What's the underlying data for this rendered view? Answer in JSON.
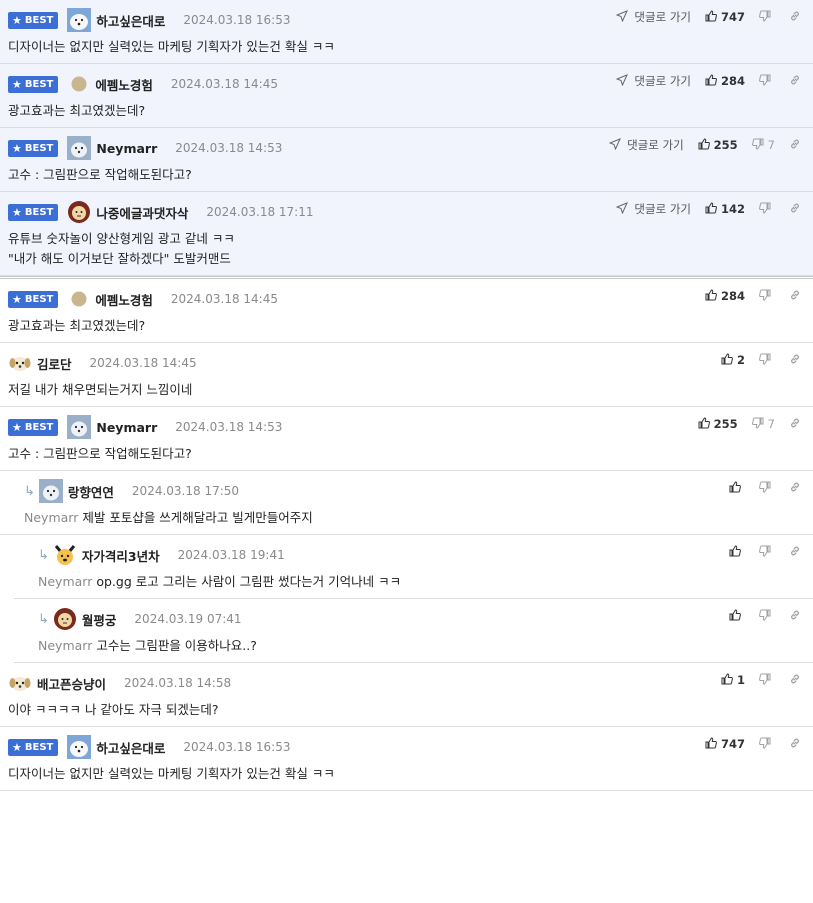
{
  "comments": [
    {
      "best": true,
      "badge": "BEST",
      "avatar": "polar-bear-avatar",
      "nick": "하고싶은대로",
      "date": "2024.03.18 16:53",
      "goto_label": "댓글로 가기",
      "likes": "747",
      "dislikes": "",
      "text": "디자이너는 없지만 실력있는 마케팅 기획자가 있는건 확실 ㅋㅋ"
    },
    {
      "best": true,
      "badge": "BEST",
      "avatar": "dot-avatar",
      "nick": "에펨노경험",
      "date": "2024.03.18 14:45",
      "goto_label": "댓글로 가기",
      "likes": "284",
      "dislikes": "",
      "text": "광고효과는 최고였겠는데?"
    },
    {
      "best": true,
      "badge": "BEST",
      "avatar": "dog-avatar",
      "nick": "Neymarr",
      "date": "2024.03.18 14:53",
      "goto_label": "댓글로 가기",
      "likes": "255",
      "dislikes": "7",
      "text": "고수 : 그림판으로 작업해도된다고?"
    },
    {
      "best": true,
      "badge": "BEST",
      "avatar": "lion-avatar",
      "nick": "나중에글과댓자삭",
      "date": "2024.03.18 17:11",
      "goto_label": "댓글로 가기",
      "likes": "142",
      "dislikes": "",
      "text": "유튜브 숫자놀이 양산형게임 광고 같네 ㅋㅋ",
      "text2": "\"내가 해도 이거보단 잘하겠다\" 도발커맨드"
    },
    {
      "badge": "BEST",
      "avatar": "dot-avatar",
      "nick": "에펨노경험",
      "date": "2024.03.18 14:45",
      "likes": "284",
      "dislikes": "",
      "text": "광고효과는 최고였겠는데?"
    },
    {
      "avatar": "puppy-avatar",
      "nick": "김로단",
      "date": "2024.03.18 14:45",
      "likes": "2",
      "dislikes": "",
      "text": "저길 내가 채우면되는거지 느낌이네"
    },
    {
      "badge": "BEST",
      "avatar": "dog-avatar",
      "nick": "Neymarr",
      "date": "2024.03.18 14:53",
      "likes": "255",
      "dislikes": "7",
      "text": "고수 : 그림판으로 작업해도된다고?"
    },
    {
      "reply": true,
      "avatar": "dog-avatar",
      "nick": "랑향연연",
      "date": "2024.03.18 17:50",
      "likes": "",
      "dislikes": "",
      "mention": "Neymarr",
      "text": "제발 포토샵을 쓰게해달라고 빌게만들어주지"
    },
    {
      "reply": true,
      "avatar": "dog-face-avatar",
      "nick": "자가격리3년차",
      "date": "2024.03.18 19:41",
      "likes": "",
      "dislikes": "",
      "mention": "Neymarr",
      "text": "op.gg 로고 그리는 사람이 그림판 썼다는거 기억나네 ㅋㅋ"
    },
    {
      "reply": true,
      "avatar": "lion-avatar",
      "nick": "월평궁",
      "date": "2024.03.19 07:41",
      "likes": "",
      "dislikes": "",
      "mention": "Neymarr",
      "text": "고수는 그림판을 이용하나요..?"
    },
    {
      "avatar": "puppy-avatar",
      "nick": "배고픈승냥이",
      "date": "2024.03.18 14:58",
      "likes": "1",
      "dislikes": "",
      "text": "이야 ㅋㅋㅋㅋ 나 같아도 자극 되겠는데?"
    },
    {
      "badge": "BEST",
      "avatar": "polar-bear-avatar",
      "nick": "하고싶은대로",
      "date": "2024.03.18 16:53",
      "likes": "747",
      "dislikes": "",
      "text": "디자이너는 없지만 실력있는 마케팅 기획자가 있는건 확실 ㅋㅋ"
    }
  ],
  "colors": {
    "best_bg": "#f1f4fc",
    "badge": "#3b6fd6",
    "text": "#222222",
    "muted": "#8a8a8a"
  }
}
